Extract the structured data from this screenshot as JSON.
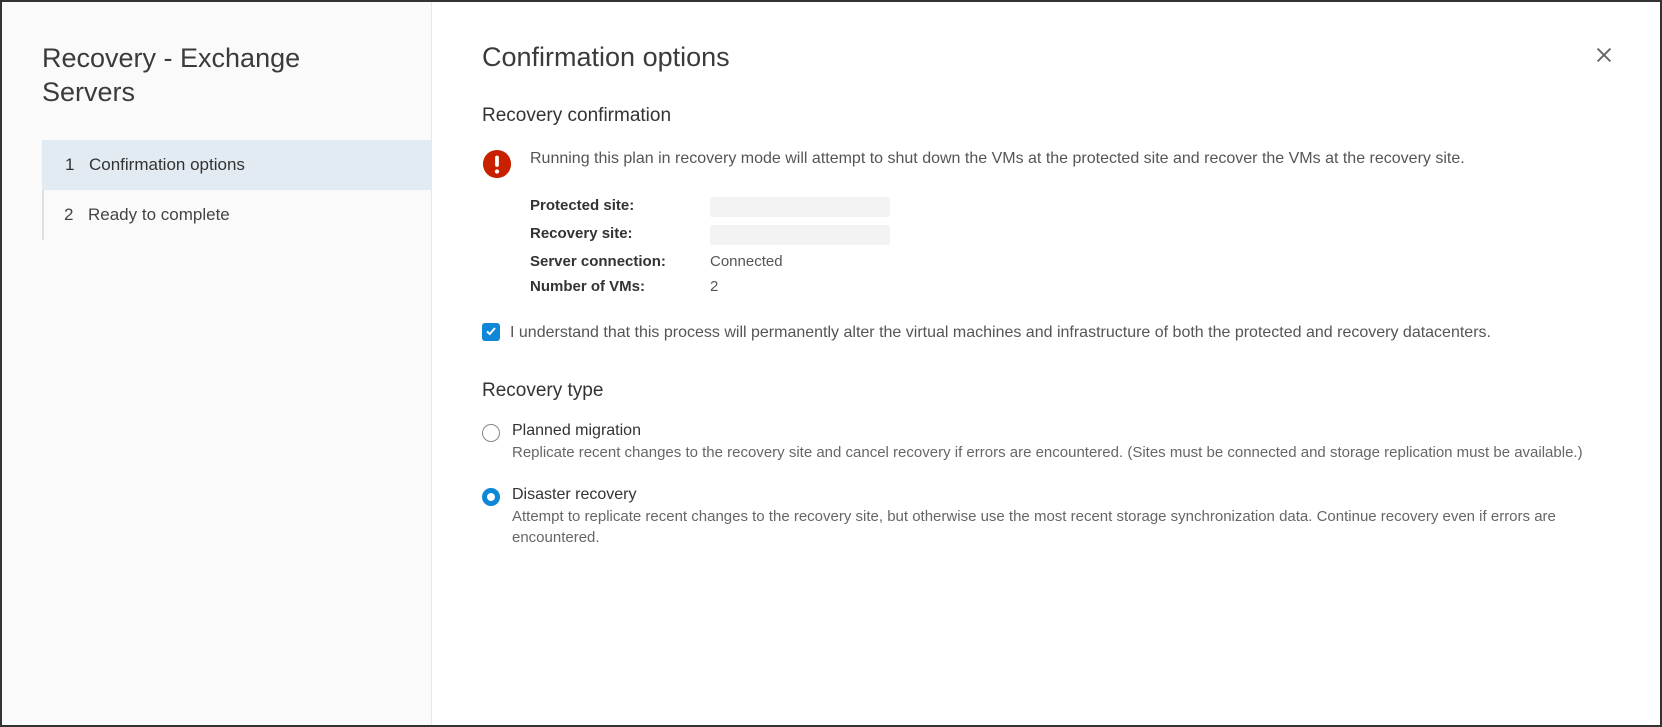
{
  "sidebar": {
    "title": "Recovery - Exchange Servers",
    "steps": [
      {
        "num": "1",
        "label": "Confirmation options",
        "active": true
      },
      {
        "num": "2",
        "label": "Ready to complete",
        "active": false
      }
    ]
  },
  "main": {
    "title": "Confirmation options",
    "confirmation": {
      "heading": "Recovery confirmation",
      "warning_text": "Running this plan in recovery mode will attempt to shut down the VMs at the protected site and recover the VMs at the recovery site.",
      "info": {
        "protected_site_label": "Protected site:",
        "protected_site_value": "",
        "recovery_site_label": "Recovery site:",
        "recovery_site_value": "",
        "connection_label": "Server connection:",
        "connection_value": "Connected",
        "vm_count_label": "Number of VMs:",
        "vm_count_value": "2"
      },
      "ack_checkbox": {
        "checked": true,
        "label": "I understand that this process will permanently alter the virtual machines and infrastructure of both the protected and recovery datacenters."
      }
    },
    "recovery_type": {
      "heading": "Recovery type",
      "options": [
        {
          "id": "planned",
          "title": "Planned migration",
          "desc": "Replicate recent changes to the recovery site and cancel recovery if errors are encountered. (Sites must be connected and storage replication must be available.)",
          "selected": false
        },
        {
          "id": "disaster",
          "title": "Disaster recovery",
          "desc": "Attempt to replicate recent changes to the recovery site, but otherwise use the most recent storage synchronization data. Continue recovery even if errors are encountered.",
          "selected": true
        }
      ]
    }
  }
}
